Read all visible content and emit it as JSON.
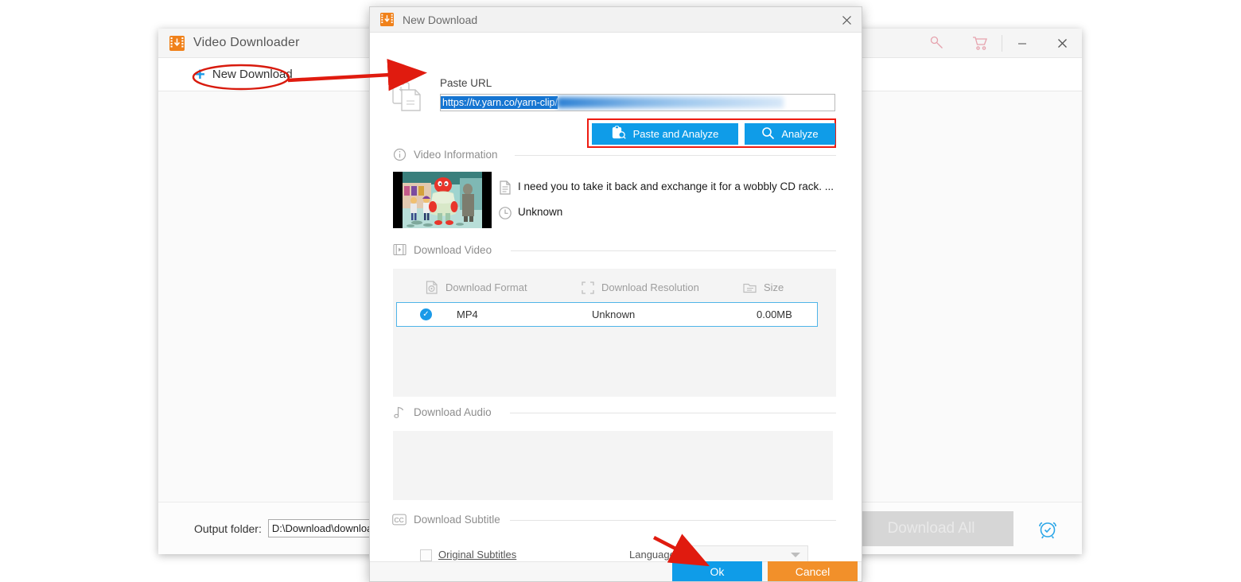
{
  "main_window": {
    "title": "Video Downloader",
    "logo_icon": "orange-film-download-icon",
    "toolbar": {
      "new_download_label": "New Download",
      "plus_icon": "plus-icon"
    },
    "titlebar_icons": [
      "key-icon",
      "cart-icon",
      "minimize-icon",
      "close-icon"
    ],
    "footer": {
      "output_folder_label": "Output folder:",
      "output_folder_value": "D:\\Download\\download video",
      "download_all_label": "Download All",
      "scheduler_icon": "alarm-clock-icon"
    }
  },
  "dialog": {
    "title": "New Download",
    "logo_icon": "orange-film-download-icon",
    "close_icon": "close-icon",
    "paste_url": {
      "icon": "clipboard-paste-icon",
      "label": "Paste URL",
      "value": "https://tv.yarn.co/yarn-clip/",
      "value_redacted_suffix": true
    },
    "actions": {
      "paste_and_analyze_label": "Paste and Analyze",
      "paste_and_analyze_icon": "clipboard-search-icon",
      "analyze_label": "Analyze",
      "analyze_icon": "search-icon"
    },
    "video_information": {
      "section_label": "Video Information",
      "section_icon": "info-icon",
      "thumbnail_alt": "video-thumbnail",
      "title_icon": "document-icon",
      "title": "I need you to take it back and exchange it for a wobbly CD rack. ...",
      "duration_icon": "clock-icon",
      "duration": "Unknown"
    },
    "download_video": {
      "section_label": "Download Video",
      "section_icon": "film-icon",
      "columns": [
        {
          "label": "Download Format",
          "icon": "disc-icon"
        },
        {
          "label": "Download Resolution",
          "icon": "resize-icon"
        },
        {
          "label": "Size",
          "icon": "file-icon"
        }
      ],
      "rows": [
        {
          "selected": true,
          "format": "MP4",
          "resolution": "Unknown",
          "size": "0.00MB"
        }
      ]
    },
    "download_audio": {
      "section_label": "Download Audio",
      "section_icon": "music-note-icon",
      "rows": []
    },
    "download_subtitle": {
      "section_label": "Download Subtitle",
      "section_icon": "cc-icon",
      "original_subtitles_label": "Original Subtitles",
      "original_subtitles_checked": false,
      "language_label": "Language",
      "language_value": ""
    },
    "footer": {
      "ok_label": "Ok",
      "cancel_label": "Cancel"
    }
  },
  "colors": {
    "accent_blue": "#0f9ce8",
    "orange": "#f2902a",
    "brand_orange": "#f0811a",
    "annotation_red": "#ee1b11",
    "selection_blue": "#1675d1"
  }
}
